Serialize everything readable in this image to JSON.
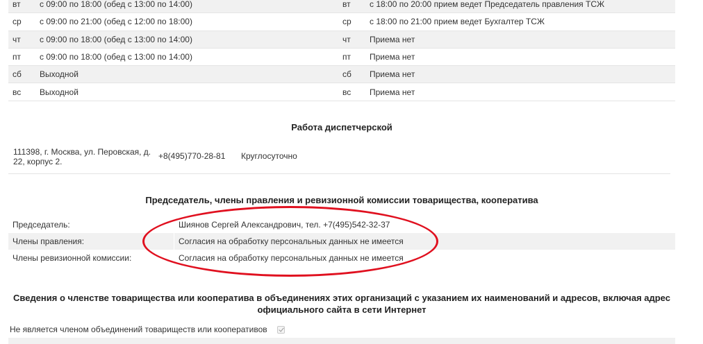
{
  "schedule": [
    {
      "day": "вт",
      "time": "с 09:00 по 18:00 (обед с 13:00 по 14:00)",
      "day2": "вт",
      "time2": "с 18:00 по 20:00 прием ведет Председатель правления ТСЖ"
    },
    {
      "day": "ср",
      "time": "с 09:00 по 21:00 (обед с 12:00 по 18:00)",
      "day2": "ср",
      "time2": "с 18:00 по 21:00 прием ведет Бухгалтер ТСЖ"
    },
    {
      "day": "чт",
      "time": "с 09:00 по 18:00 (обед с 13:00 по 14:00)",
      "day2": "чт",
      "time2": "Приема нет"
    },
    {
      "day": "пт",
      "time": "с 09:00 по 18:00 (обед с 13:00 по 14:00)",
      "day2": "пт",
      "time2": "Приема нет"
    },
    {
      "day": "сб",
      "time": "Выходной",
      "day2": "сб",
      "time2": "Приема нет"
    },
    {
      "day": "вс",
      "time": "Выходной",
      "day2": "вс",
      "time2": "Приема нет"
    }
  ],
  "dispatch": {
    "title": "Работа диспетчерской",
    "address": "111398, г. Москва, ул. Перовская, д. 22, корпус 2.",
    "phone": "+8(495)770-28-81",
    "hours": "Круглосуточно"
  },
  "board": {
    "title": "Председатель, члены правления и ревизионной комиссии товарищества, кооператива",
    "rows": [
      {
        "role": "Председатель:",
        "value": "Шиянов Сергей Александрович, тел. +7(495)542-32-37"
      },
      {
        "role": "Члены правления:",
        "value": "Согласия на обработку персональных данных не имеется"
      },
      {
        "role": "Члены ревизионной комиссии:",
        "value": "Согласия на обработку персональных данных не имеется"
      }
    ]
  },
  "membership": {
    "title": "Сведения о членстве товарищества или кооператива в объединениях этих организаций с указанием их наименований и адресов, включая адрес официального сайта в сети Интернет",
    "not_member_label": "Не является членом объединений товариществ или кооперативов"
  },
  "colors": {
    "annotation_circle": "#e0101f",
    "row_stripe": "#f1f1f1"
  }
}
